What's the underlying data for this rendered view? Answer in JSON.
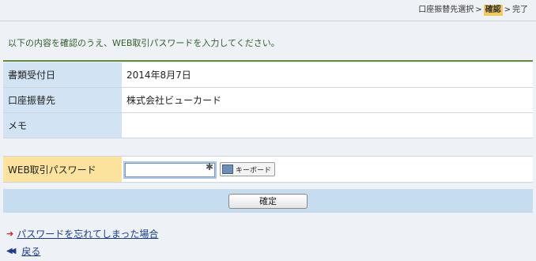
{
  "steps": {
    "step1": "口座振替先選択",
    "sep": ">",
    "step2": "確認",
    "step3": "完了"
  },
  "instruction": "以下の内容を確認のうえ、WEB取引パスワードを入力してください。",
  "info_rows": [
    {
      "label": "書類受付日",
      "value": "2014年8月7日"
    },
    {
      "label": "口座振替先",
      "value": "株式会社ビューカード"
    },
    {
      "label": "メモ",
      "value": ""
    }
  ],
  "password": {
    "label": "WEB取引パスワード",
    "value": "",
    "keyboard_label": "キーボード"
  },
  "confirm_label": "確定",
  "links": {
    "forgot": "パスワードを忘れてしまった場合",
    "back": "戻る"
  }
}
